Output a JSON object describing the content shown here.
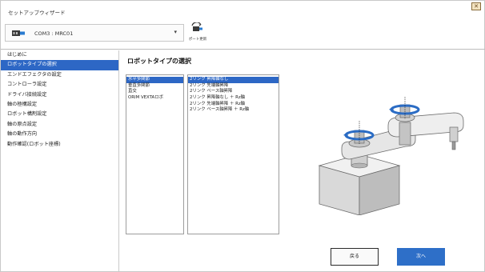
{
  "window": {
    "title": "セットアップウィザード",
    "corner_button": "✕"
  },
  "port": {
    "label": "COM3 : MRC01",
    "caret": "▾",
    "refresh_label": "ポート更新"
  },
  "sidebar": {
    "items": [
      {
        "label": "はじめに"
      },
      {
        "label": "ロボットタイプの選択"
      },
      {
        "label": "エンドエフェクタの設定"
      },
      {
        "label": "コントローラ設定"
      },
      {
        "label": "ドライバ接続設定"
      },
      {
        "label": "軸の極構設定"
      },
      {
        "label": "ロボット構剤設定"
      },
      {
        "label": "軸の原点設定"
      },
      {
        "label": "軸の動作方向"
      },
      {
        "label": "動作確認(ロボット座標)"
      }
    ],
    "active_index": 1
  },
  "main": {
    "title": "ロボットタイプの選択",
    "types": [
      "水平多関節",
      "垂直多関節",
      "直交",
      "ORIM VEXTAロボ"
    ],
    "selected_type_index": 0,
    "variants": [
      "2リンク 昇降軸なし",
      "2リンク 先端軸昇降",
      "2リンク ベース軸昇降",
      "2リンク 昇降軸なし ＋ Rz軸",
      "2リンク 先端軸昇降 ＋ Rz軸",
      "2リンク ベース軸昇降 ＋ Rz軸"
    ],
    "selected_variant_index": 0
  },
  "buttons": {
    "back": "戻る",
    "next": "次へ"
  },
  "colors": {
    "selection": "#2d67c5",
    "next_button": "#2e6fc8",
    "rotation_arrow": "#2b6cc4"
  }
}
